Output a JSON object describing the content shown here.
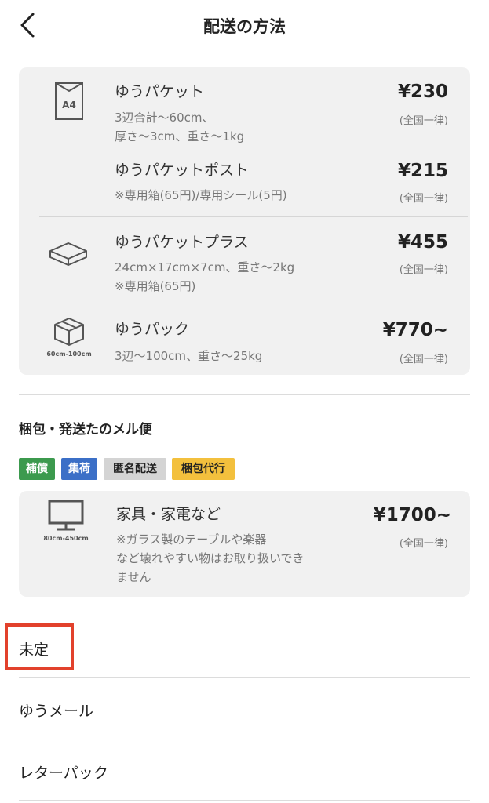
{
  "header": {
    "title": "配送の方法"
  },
  "card1": {
    "rows": [
      {
        "icon_label": "A4",
        "name": "ゆうパケット",
        "desc": [
          "3辺合計〜60cm、",
          "厚さ〜3cm、重さ〜1kg"
        ],
        "price": "¥230",
        "price_note": "(全国一律)"
      },
      {
        "name": "ゆうパケットポスト",
        "desc": [
          "※専用箱(65円)/専用シール(5円)"
        ],
        "price": "¥215",
        "price_note": "(全国一律)"
      },
      {
        "name": "ゆうパケットプラス",
        "desc": [
          "24cm×17cm×7cm、重さ〜2kg",
          "※専用箱(65円)"
        ],
        "price": "¥455",
        "price_note": "(全国一律)"
      },
      {
        "icon_caption": "60cm-100cm",
        "name": "ゆうパック",
        "desc": [
          "3辺〜100cm、重さ〜25kg"
        ],
        "price": "¥770~",
        "price_note": "(全国一律)"
      }
    ]
  },
  "section": {
    "title": "梱包・発送たのメル便",
    "tags": [
      "補償",
      "集荷",
      "匿名配送",
      "梱包代行"
    ]
  },
  "card2": {
    "icon_caption": "80cm-450cm",
    "name": "家具・家電など",
    "desc": [
      "※ガラス製のテーブルや楽器",
      "など壊れやすい物はお取り扱いでき",
      "ません"
    ],
    "price": "¥1700~",
    "price_note": "(全国一律)"
  },
  "options": [
    "未定",
    "ゆうメール",
    "レターパック"
  ],
  "colors": {
    "highlight": "#e2412c",
    "tag_green": "#3c9a4e",
    "tag_blue": "#3b6fc7",
    "tag_yellow": "#f3c03d"
  }
}
